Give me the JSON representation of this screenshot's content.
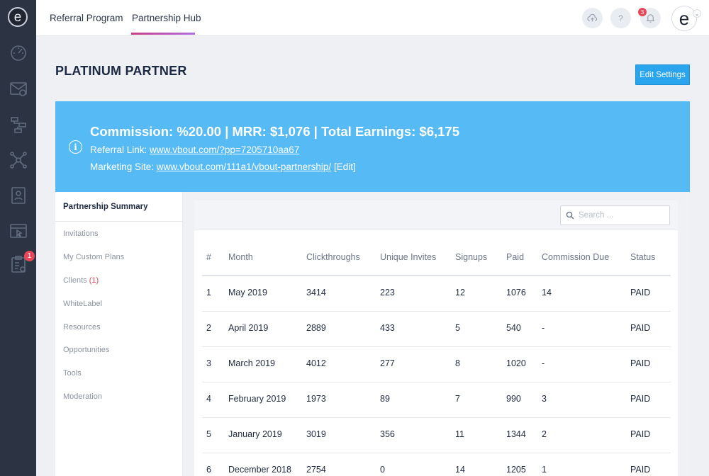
{
  "tabs": [
    {
      "label": "Referral Program",
      "active": false
    },
    {
      "label": "Partnership Hub",
      "active": true
    }
  ],
  "notifications": {
    "bell_count": "3",
    "rail_badge": "1"
  },
  "help_label": "?",
  "avatar_letter": "e",
  "rail_logo_letter": "e",
  "page_title": "PLATINUM PARTNER",
  "edit_button": "Edit Settings",
  "banner": {
    "headline": "Commission: %20.00 | MRR: $1,076 | Total Earnings: $6,175",
    "referral_label": "Referral Link: ",
    "referral_url": "www.vbout.com/?pp=7205710aa67",
    "marketing_label": "Marketing Site: ",
    "marketing_url": "www.vbout.com/111a1/vbout-partnership/",
    "marketing_edit": " [Edit]"
  },
  "sidebar": {
    "active": "Partnership Summary",
    "items": [
      {
        "label": "Invitations",
        "count": ""
      },
      {
        "label": "My Custom Plans",
        "count": ""
      },
      {
        "label": "Clients",
        "count": "(1)"
      },
      {
        "label": "WhiteLabel",
        "count": ""
      },
      {
        "label": "Resources",
        "count": ""
      },
      {
        "label": "Opportunities",
        "count": ""
      },
      {
        "label": "Tools",
        "count": ""
      },
      {
        "label": "Moderation",
        "count": ""
      }
    ]
  },
  "search": {
    "placeholder": "Search ..."
  },
  "table": {
    "columns": [
      "#",
      "Month",
      "Clickthroughs",
      "Unique Invites",
      "Signups",
      "Paid",
      "Commission Due",
      "Status"
    ],
    "rows": [
      [
        "1",
        "May 2019",
        "3414",
        "223",
        "12",
        "1076",
        "14",
        "PAID"
      ],
      [
        "2",
        "April 2019",
        "2889",
        "433",
        "5",
        "540",
        "-",
        "PAID"
      ],
      [
        "3",
        "March 2019",
        "4012",
        "277",
        "8",
        "1020",
        "-",
        "PAID"
      ],
      [
        "4",
        "February 2019",
        "1973",
        "89",
        "7",
        "990",
        "3",
        "PAID"
      ],
      [
        "5",
        "January 2019",
        "3019",
        "356",
        "11",
        "1344",
        "2",
        "PAID"
      ],
      [
        "6",
        "December 2018",
        "2754",
        "0",
        "14",
        "1205",
        "1",
        "PAID"
      ]
    ]
  },
  "colors": {
    "accent": "#2aa4ec",
    "banner": "#56baf4",
    "rail": "#2c3443",
    "badge": "#e9465a"
  }
}
